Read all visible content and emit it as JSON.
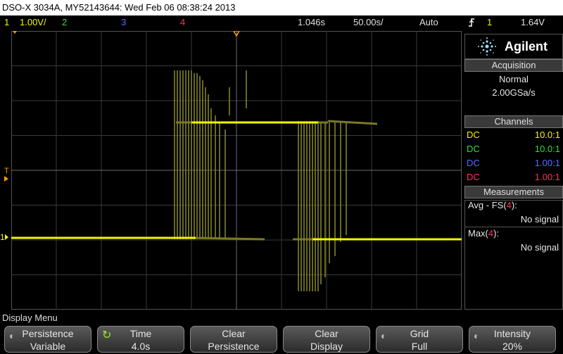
{
  "title": "DSO-X 3034A, MY52143644: Wed Feb 06 08:38:24 2013",
  "status": {
    "ch1_num": "1",
    "ch1_scale": "1.00V/",
    "ch2_num": "2",
    "ch3_num": "3",
    "ch4_num": "4",
    "time_offset": "1.046s",
    "timebase": "50.00s/",
    "trigger_mode": "Auto",
    "trigger_icon": "trigger-edge-icon",
    "trigger_source": "1",
    "trigger_level": "1.64V"
  },
  "markers": {
    "trigger_marker": "T",
    "ch1_ground_marker": "1"
  },
  "sidebar": {
    "brand": "Agilent",
    "acquisition_header": "Acquisition",
    "acquisition_mode": "Normal",
    "sample_rate": "2.00GSa/s",
    "channels_header": "Channels",
    "channels": [
      {
        "coupling": "DC",
        "probe": "10.0:1",
        "color": "#f5f500"
      },
      {
        "coupling": "DC",
        "probe": "10.0:1",
        "color": "#33dd33"
      },
      {
        "coupling": "DC",
        "probe": "1.00:1",
        "color": "#5a6bff"
      },
      {
        "coupling": "DC",
        "probe": "1.00:1",
        "color": "#ff3060"
      }
    ],
    "measurements_header": "Measurements",
    "measurements": [
      {
        "label_prefix": "Avg - FS(",
        "channel": "4",
        "label_suffix": "):",
        "value": "No signal"
      },
      {
        "label_prefix": "Max(",
        "channel": "4",
        "label_suffix": "):",
        "value": "No signal"
      }
    ]
  },
  "menu_title": "Display Menu",
  "softkeys": [
    {
      "line1": "Persistence",
      "line2": "Variable",
      "icon": "knob-icon"
    },
    {
      "line1": "Time",
      "line2": "4.0s",
      "icon": "rotate-icon"
    },
    {
      "line1": "Clear",
      "line2": "Persistence",
      "icon": ""
    },
    {
      "line1": "Clear",
      "line2": "Display",
      "icon": ""
    },
    {
      "line1": "Grid",
      "line2": "Full",
      "icon": "knob-icon"
    },
    {
      "line1": "Intensity",
      "line2": "20%",
      "icon": "knob-icon"
    }
  ],
  "colors": {
    "ch1": "#f5f500",
    "ch2": "#33dd33",
    "ch3": "#5a6bff",
    "ch4": "#ff3060",
    "trigger_marker": "#ff9a00",
    "persistence": "#8a8a2a"
  }
}
